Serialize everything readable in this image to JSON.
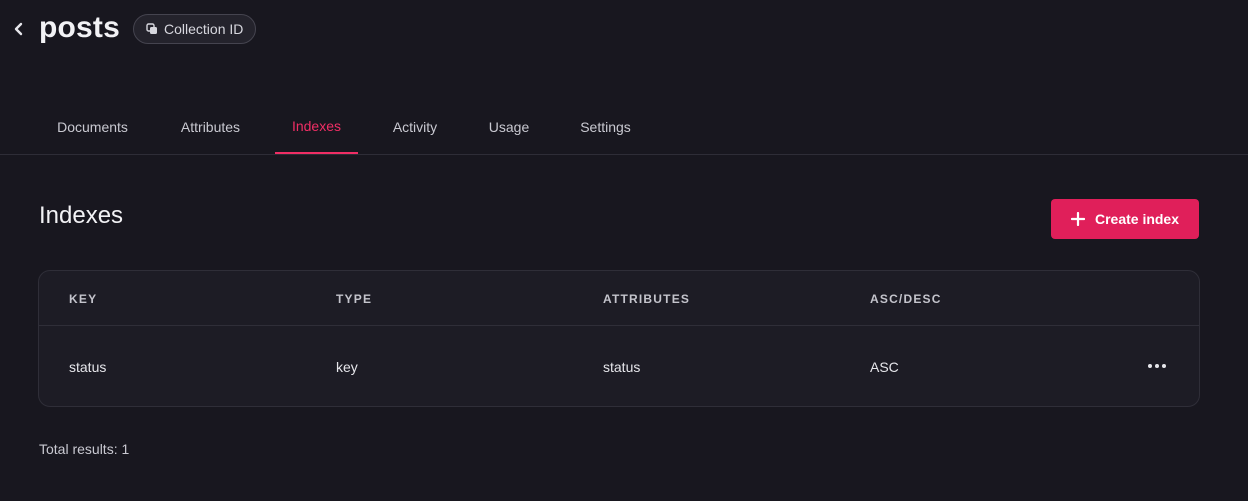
{
  "header": {
    "title": "posts",
    "collection_id_label": "Collection ID"
  },
  "tabs": [
    {
      "label": "Documents",
      "active": false
    },
    {
      "label": "Attributes",
      "active": false
    },
    {
      "label": "Indexes",
      "active": true
    },
    {
      "label": "Activity",
      "active": false
    },
    {
      "label": "Usage",
      "active": false
    },
    {
      "label": "Settings",
      "active": false
    }
  ],
  "section": {
    "title": "Indexes",
    "create_button_label": "Create index"
  },
  "table": {
    "columns": [
      "KEY",
      "TYPE",
      "ATTRIBUTES",
      "ASC/DESC"
    ],
    "rows": [
      {
        "key": "status",
        "type": "key",
        "attributes": "status",
        "order": "ASC"
      }
    ]
  },
  "footer": {
    "total_results": "Total results: 1"
  },
  "colors": {
    "background": "#18171f",
    "accent": "#f02e65",
    "button": "#e01f5a"
  },
  "icons": {
    "back": "chevron-left-icon",
    "copy": "copy-icon",
    "plus": "plus-icon",
    "more": "more-horizontal-icon"
  }
}
